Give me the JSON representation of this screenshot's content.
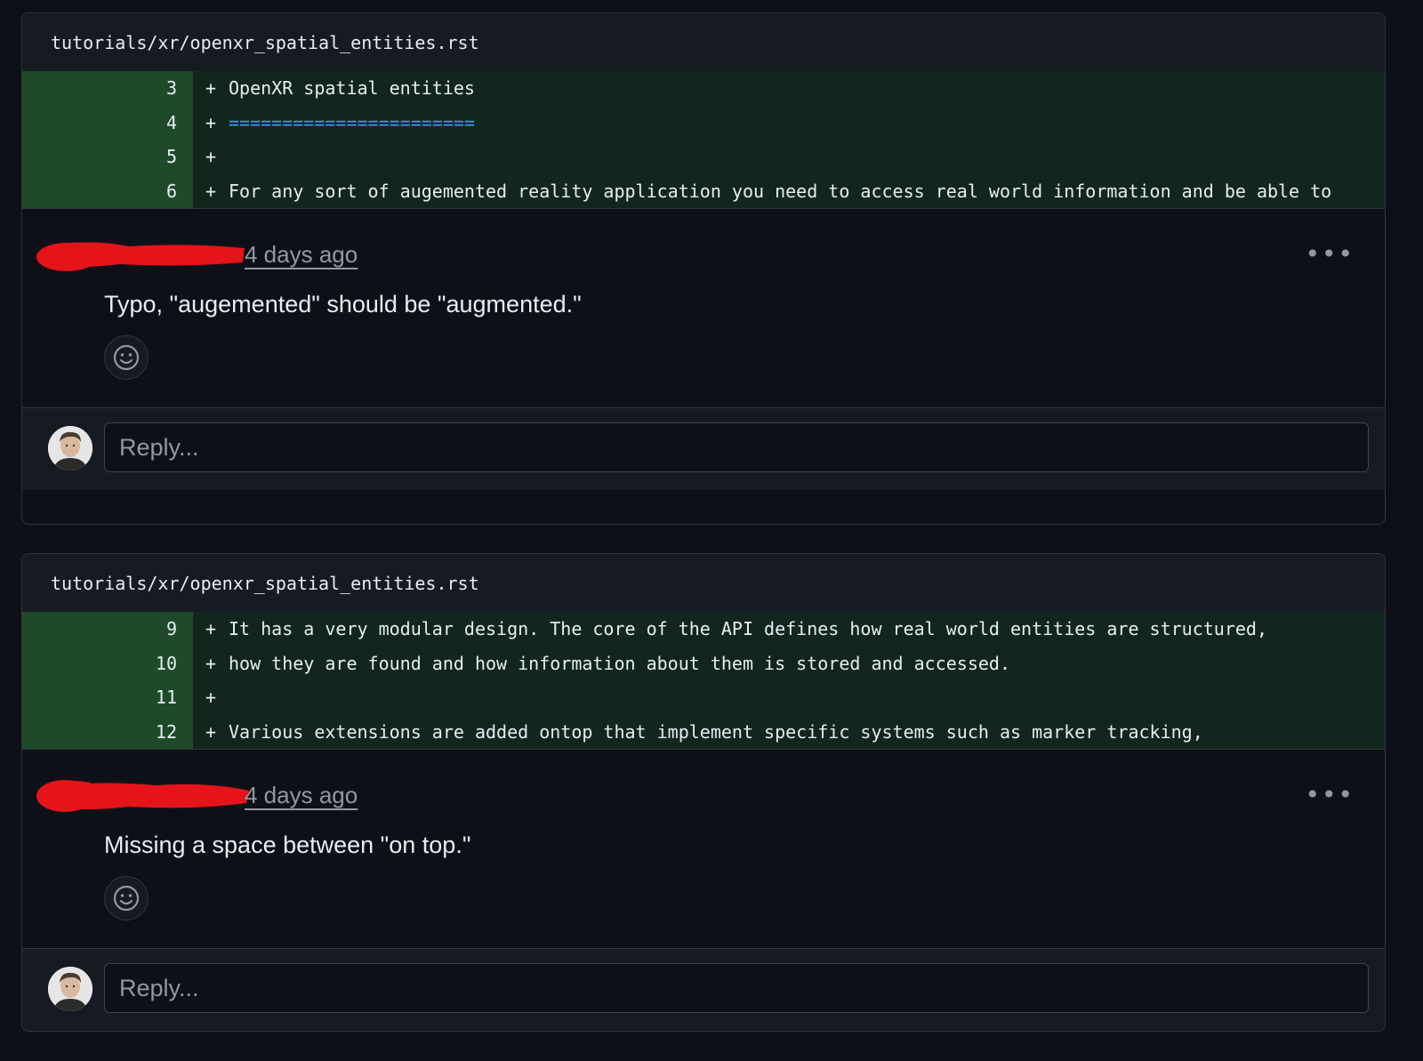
{
  "threads": [
    {
      "file_path": "tutorials/xr/openxr_spatial_entities.rst",
      "diff_lines": [
        {
          "num": "3",
          "sign": "+",
          "text": "OpenXR spatial entities"
        },
        {
          "num": "4",
          "sign": "+",
          "text": "======================="
        },
        {
          "num": "5",
          "sign": "+",
          "text": ""
        },
        {
          "num": "6",
          "sign": "+",
          "text": "For any sort of augemented reality application you need to access real world information and be able to"
        }
      ],
      "comment": {
        "timestamp": "4 days ago",
        "body": "Typo, \"augemented\" should be \"augmented.\""
      },
      "reply_placeholder": "Reply..."
    },
    {
      "file_path": "tutorials/xr/openxr_spatial_entities.rst",
      "diff_lines": [
        {
          "num": "9",
          "sign": "+",
          "text": "It has a very modular design. The core of the API defines how real world entities are structured,"
        },
        {
          "num": "10",
          "sign": "+",
          "text": "how they are found and how information about them is stored and accessed."
        },
        {
          "num": "11",
          "sign": "+",
          "text": ""
        },
        {
          "num": "12",
          "sign": "+",
          "text": "Various extensions are added ontop that implement specific systems such as marker tracking,"
        }
      ],
      "comment": {
        "timestamp": "4 days ago",
        "body": "Missing a space between \"on top.\""
      },
      "reply_placeholder": "Reply..."
    }
  ],
  "icons": {
    "more": "kebab-horizontal-icon",
    "emoji": "smiley-icon",
    "avatar": "user-avatar"
  },
  "colors": {
    "background": "#0d1117",
    "diff_added_bg": "#12261e",
    "diff_gutter_bg": "#1f4a2a",
    "heading_underline": "#4493f8",
    "redaction": "#e5141b"
  }
}
